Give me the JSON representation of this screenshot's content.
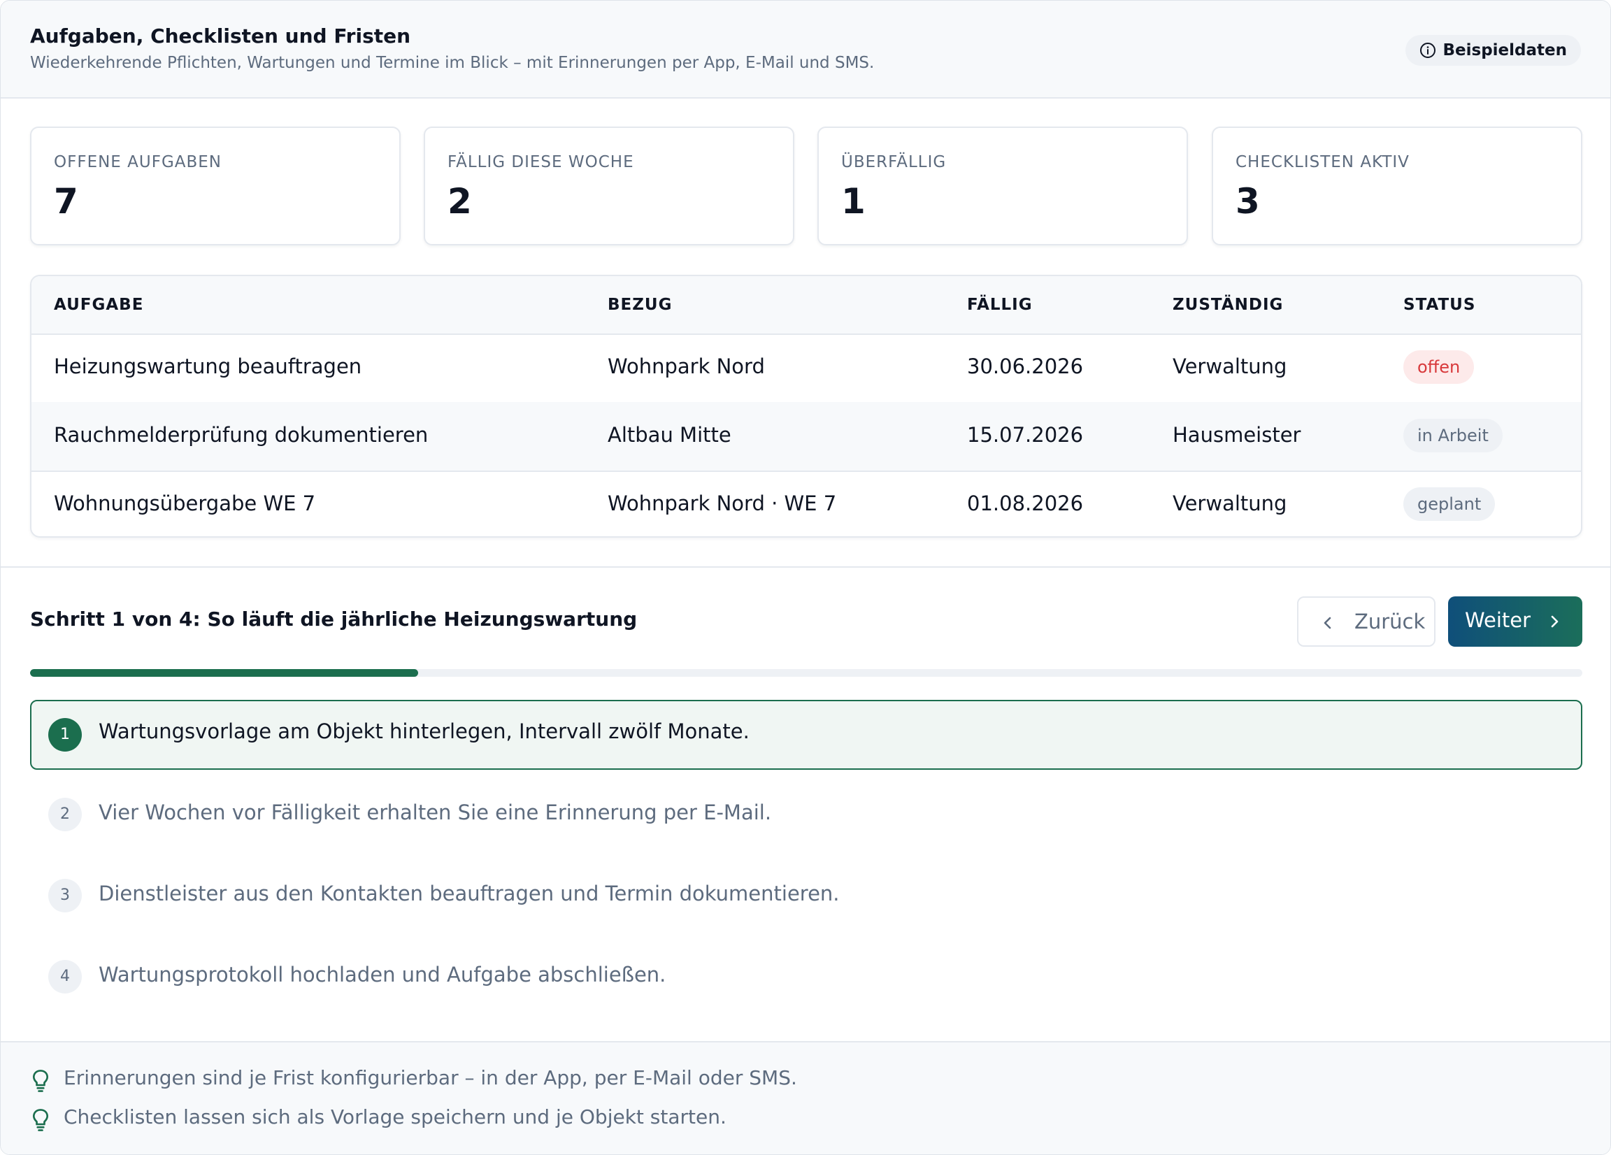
{
  "header": {
    "title": "Aufgaben, Checklisten und Fristen",
    "subtitle": "Wiederkehrende Pflichten, Wartungen und Termine im Blick – mit Erinnerungen per App, E-Mail und SMS.",
    "badge_label": "Beispieldaten"
  },
  "stats": [
    {
      "label": "OFFENE AUFGABEN",
      "value": "7"
    },
    {
      "label": "FÄLLIG DIESE WOCHE",
      "value": "2"
    },
    {
      "label": "ÜBERFÄLLIG",
      "value": "1"
    },
    {
      "label": "CHECKLISTEN AKTIV",
      "value": "3"
    }
  ],
  "table": {
    "headers": {
      "aufgabe": "AUFGABE",
      "bezug": "BEZUG",
      "faellig": "FÄLLIG",
      "zustaendig": "ZUSTÄNDIG",
      "status": "STATUS"
    },
    "rows": [
      {
        "aufgabe": "Heizungswartung beauftragen",
        "bezug": "Wohnpark Nord",
        "faellig": "30.06.2026",
        "zustaendig": "Verwaltung",
        "status": "offen"
      },
      {
        "aufgabe": "Rauchmelderprüfung dokumentieren",
        "bezug": "Altbau Mitte",
        "faellig": "15.07.2026",
        "zustaendig": "Hausmeister",
        "status": "in Arbeit"
      },
      {
        "aufgabe": "Wohnungsübergabe WE 7",
        "bezug": "Wohnpark Nord · WE 7",
        "faellig": "01.08.2026",
        "zustaendig": "Verwaltung",
        "status": "geplant"
      }
    ]
  },
  "walkthrough": {
    "title": "Schritt 1 von 4: So läuft die jährliche Heizungswartung",
    "back_label": "Zurück",
    "next_label": "Weiter",
    "progress_fraction": 0.25,
    "steps": [
      {
        "num": "1",
        "text": "Wartungsvorlage am Objekt hinterlegen, Intervall zwölf Monate."
      },
      {
        "num": "2",
        "text": "Vier Wochen vor Fälligkeit erhalten Sie eine Erinnerung per E-Mail."
      },
      {
        "num": "3",
        "text": "Dienstleister aus den Kontakten beauftragen und Termin dokumentieren."
      },
      {
        "num": "4",
        "text": "Wartungsprotokoll hochladen und Aufgabe abschließen."
      }
    ]
  },
  "tips": [
    "Erinnerungen sind je Frist konfigurierbar – in der App, per E-Mail oder SMS.",
    "Checklisten lassen sich als Vorlage speichern und je Objekt starten."
  ],
  "colors": {
    "accent_green": "#1b6e4e",
    "accent_blue": "#0f4f7a",
    "status_open": "#d8393b"
  },
  "icons": [
    "info-icon",
    "chevron-left-icon",
    "chevron-right-icon",
    "lightbulb-icon"
  ]
}
